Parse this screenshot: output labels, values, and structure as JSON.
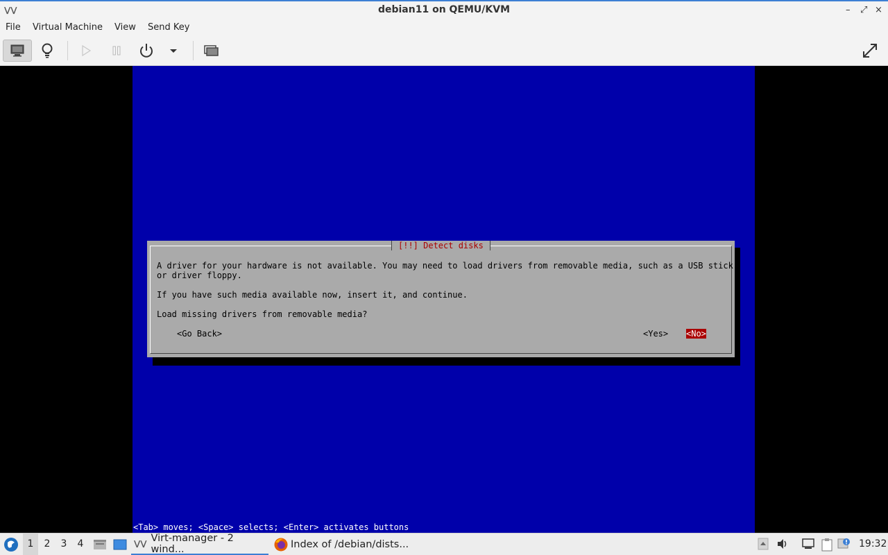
{
  "window": {
    "title": "debian11 on QEMU/KVM",
    "minimize": "–",
    "maximize": "⤢",
    "close": "×",
    "app_glyph": "⋁⋁"
  },
  "menubar": {
    "items": [
      "File",
      "Virtual Machine",
      "View",
      "Send Key"
    ]
  },
  "toolbar": {
    "buttons": [
      "console-view",
      "details-view",
      "run",
      "pause",
      "shutdown",
      "shutdown-menu",
      "snapshots",
      "fullscreen"
    ]
  },
  "installer": {
    "dialog_title": "[!!] Detect disks",
    "lines": [
      "A driver for your hardware is not available. You may need to load drivers from removable media, such as a USB stick,",
      "or driver floppy.",
      "If you have such media available now, insert it, and continue.",
      "Load missing drivers from removable media?"
    ],
    "buttons": {
      "back": "<Go Back>",
      "yes": "<Yes>",
      "no": "<No>"
    },
    "selected_button": "no",
    "hint": "<Tab> moves; <Space> selects; <Enter> activates buttons",
    "colors": {
      "background": "#0000aa",
      "dialog": "#aaaaaa",
      "title": "#aa0000",
      "selected": "#aa0000"
    }
  },
  "taskbar": {
    "workspaces": [
      "1",
      "2",
      "3",
      "4"
    ],
    "active_workspace": "1",
    "tasks": [
      {
        "label": "Virt-manager - 2 wind...",
        "icon": "virt-manager-icon"
      },
      {
        "label": "Index of /debian/dists...",
        "icon": "firefox-icon"
      }
    ],
    "clock": "19:32"
  }
}
